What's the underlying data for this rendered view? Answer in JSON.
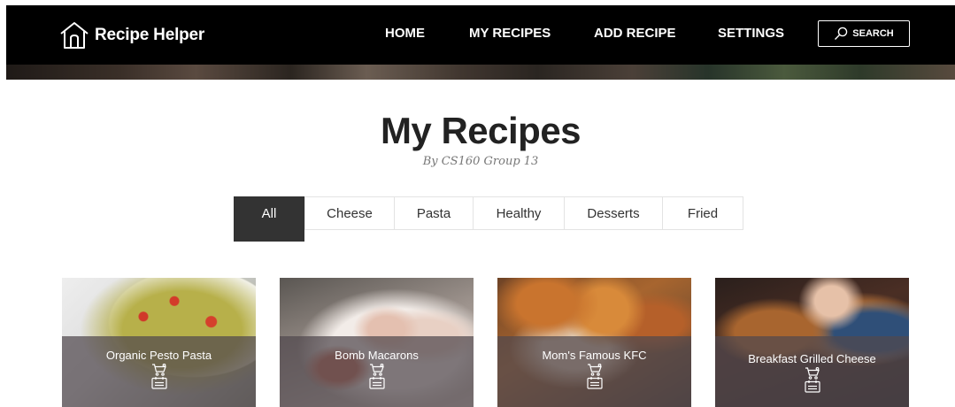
{
  "header": {
    "app_name": "Recipe Helper",
    "nav": [
      "HOME",
      "MY RECIPES",
      "ADD RECIPE",
      "SETTINGS"
    ],
    "search_label": "SEARCH",
    "logo_icon": "house-icon",
    "search_icon": "magnifier-icon"
  },
  "main": {
    "title": "My Recipes",
    "subtitle": "By CS160 Group 13"
  },
  "filters": {
    "active": "All",
    "items": [
      "All",
      "Cheese",
      "Pasta",
      "Healthy",
      "Desserts",
      "Fried"
    ]
  },
  "recipes": [
    {
      "name": "Organic Pesto Pasta",
      "icons": [
        "shopping-cart-icon",
        "recipe-card-icon"
      ]
    },
    {
      "name": "Bomb Macarons",
      "icons": [
        "shopping-cart-icon",
        "recipe-card-icon"
      ]
    },
    {
      "name": "Mom's Famous KFC",
      "icons": [
        "shopping-cart-icon",
        "recipe-card-icon"
      ]
    },
    {
      "name": "Breakfast Grilled Cheese",
      "icons": [
        "shopping-cart-icon",
        "recipe-card-icon"
      ]
    }
  ],
  "colors": {
    "header_bg": "#000000",
    "active_tab": "#333333",
    "card_overlay": "#50484e"
  }
}
